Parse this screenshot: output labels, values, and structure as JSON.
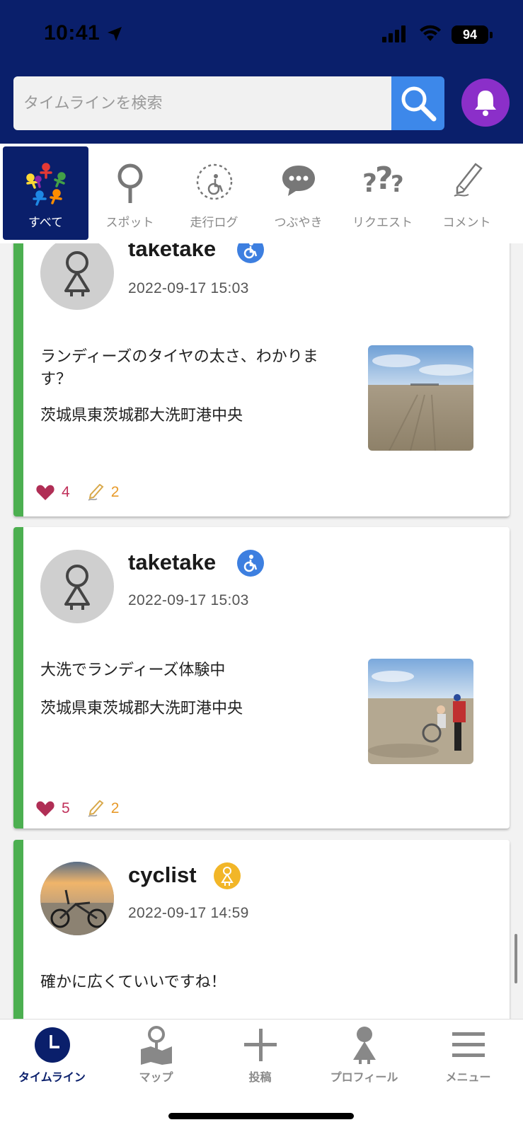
{
  "status_bar": {
    "time": "10:41",
    "battery": "94"
  },
  "search": {
    "placeholder": "タイムラインを検索"
  },
  "categories": [
    {
      "label": "すべて",
      "icon": "people-circle-icon",
      "active": true
    },
    {
      "label": "スポット",
      "icon": "pin-icon",
      "active": false
    },
    {
      "label": "走行ログ",
      "icon": "wheelchair-route-icon",
      "active": false
    },
    {
      "label": "つぶやき",
      "icon": "speech-bubble-icon",
      "active": false
    },
    {
      "label": "リクエスト",
      "icon": "question-marks-icon",
      "active": false
    },
    {
      "label": "コメント",
      "icon": "pencil-icon",
      "active": false
    }
  ],
  "posts": [
    {
      "username": "taketake",
      "badge": "wheelchair-badge-icon",
      "date": "2022-09-17 15:03",
      "text": "ランディーズのタイヤの太さ、わかります？",
      "place": "茨城県東茨城郡大洗町港中央",
      "likes": "4",
      "comments": "2"
    },
    {
      "username": "taketake",
      "badge": "wheelchair-badge-icon",
      "date": "2022-09-17 15:03",
      "text": "大洗でランディーズ体験中",
      "place": "茨城県東茨城郡大洗町港中央",
      "likes": "5",
      "comments": "2"
    },
    {
      "username": "cyclist",
      "badge": "person-badge-icon",
      "date": "2022-09-17 14:59",
      "text": "確かに広くていいですね！"
    }
  ],
  "bottom_nav": [
    {
      "label": "タイムライン",
      "icon": "clock-icon",
      "active": true
    },
    {
      "label": "マップ",
      "icon": "map-pin-icon",
      "active": false
    },
    {
      "label": "投稿",
      "icon": "plus-icon",
      "active": false
    },
    {
      "label": "プロフィール",
      "icon": "person-icon",
      "active": false
    },
    {
      "label": "メニュー",
      "icon": "hamburger-icon",
      "active": false
    }
  ],
  "colors": {
    "header": "#0a1f6b",
    "search_button": "#3d88ea",
    "bell": "#8b2fc9",
    "card_accent": "#4caf50",
    "like": "#c0305a",
    "comment": "#e89a2a"
  }
}
